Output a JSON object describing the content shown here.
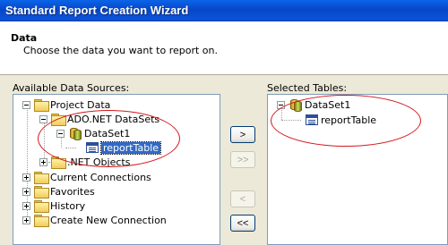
{
  "window": {
    "title": "Standard Report Creation Wizard"
  },
  "header": {
    "title": "Data",
    "subtitle": "Choose the data you want to report on."
  },
  "available": {
    "label": "Available Data Sources:",
    "nodes": {
      "project_data": "Project Data",
      "ado_net": "ADO.NET DataSets",
      "dataset1": "DataSet1",
      "report_table": "reportTable",
      "net_objects": ".NET Objects",
      "current_connections": "Current Connections",
      "favorites": "Favorites",
      "history": "History",
      "create_new": "Create New Connection"
    }
  },
  "selected": {
    "label": "Selected Tables:",
    "nodes": {
      "dataset1": "DataSet1",
      "report_table": "reportTable"
    }
  },
  "buttons": {
    "add": ">",
    "add_all": ">>",
    "remove": "<",
    "remove_all": "<<"
  },
  "colors": {
    "title_bar": "#0a54d8",
    "selection": "#316ac5",
    "highlight_ellipse": "#d4181c"
  }
}
